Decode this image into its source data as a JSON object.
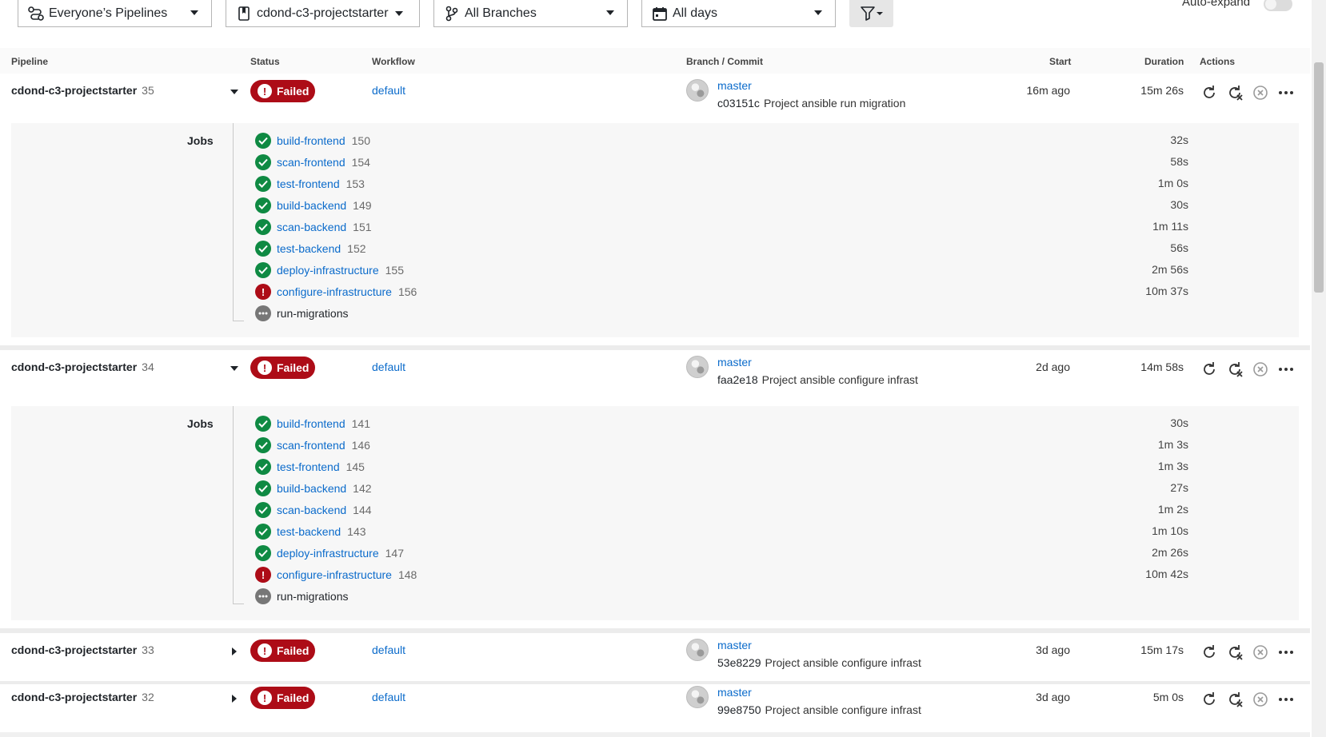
{
  "filters": {
    "pipelines": "Everyone’s Pipelines",
    "project": "cdond-c3-projectstarter",
    "branches": "All Branches",
    "days": "All days",
    "auto_expand": "Auto-expand"
  },
  "columns": {
    "pipeline": "Pipeline",
    "status": "Status",
    "workflow": "Workflow",
    "branch_commit": "Branch / Commit",
    "start": "Start",
    "duration": "Duration",
    "actions": "Actions"
  },
  "jobs_label": "Jobs",
  "colors": {
    "failed": "#ad0c17",
    "success": "#0f8a43",
    "link": "#0b6bcb"
  },
  "pipelines": [
    {
      "name": "cdond-c3-projectstarter",
      "number": "35",
      "status": "Failed",
      "workflow": "default",
      "branch": "master",
      "sha": "c03151c",
      "message": "Project ansible run migration",
      "start": "16m ago",
      "duration": "15m 26s",
      "jobs": [
        {
          "name": "build-frontend",
          "number": "150",
          "duration": "32s",
          "status": "success"
        },
        {
          "name": "scan-frontend",
          "number": "154",
          "duration": "58s",
          "status": "success"
        },
        {
          "name": "test-frontend",
          "number": "153",
          "duration": "1m 0s",
          "status": "success"
        },
        {
          "name": "build-backend",
          "number": "149",
          "duration": "30s",
          "status": "success"
        },
        {
          "name": "scan-backend",
          "number": "151",
          "duration": "1m 11s",
          "status": "success"
        },
        {
          "name": "test-backend",
          "number": "152",
          "duration": "56s",
          "status": "success"
        },
        {
          "name": "deploy-infrastructure",
          "number": "155",
          "duration": "2m 56s",
          "status": "success"
        },
        {
          "name": "configure-infrastructure",
          "number": "156",
          "duration": "10m 37s",
          "status": "failed"
        },
        {
          "name": "run-migrations",
          "number": "",
          "duration": "",
          "status": "not-run"
        }
      ]
    },
    {
      "name": "cdond-c3-projectstarter",
      "number": "34",
      "status": "Failed",
      "workflow": "default",
      "branch": "master",
      "sha": "faa2e18",
      "message": "Project ansible configure infrast",
      "start": "2d ago",
      "duration": "14m 58s",
      "jobs": [
        {
          "name": "build-frontend",
          "number": "141",
          "duration": "30s",
          "status": "success"
        },
        {
          "name": "scan-frontend",
          "number": "146",
          "duration": "1m 3s",
          "status": "success"
        },
        {
          "name": "test-frontend",
          "number": "145",
          "duration": "1m 3s",
          "status": "success"
        },
        {
          "name": "build-backend",
          "number": "142",
          "duration": "27s",
          "status": "success"
        },
        {
          "name": "scan-backend",
          "number": "144",
          "duration": "1m 2s",
          "status": "success"
        },
        {
          "name": "test-backend",
          "number": "143",
          "duration": "1m 10s",
          "status": "success"
        },
        {
          "name": "deploy-infrastructure",
          "number": "147",
          "duration": "2m 26s",
          "status": "success"
        },
        {
          "name": "configure-infrastructure",
          "number": "148",
          "duration": "10m 42s",
          "status": "failed"
        },
        {
          "name": "run-migrations",
          "number": "",
          "duration": "",
          "status": "not-run"
        }
      ]
    },
    {
      "name": "cdond-c3-projectstarter",
      "number": "33",
      "status": "Failed",
      "workflow": "default",
      "branch": "master",
      "sha": "53e8229",
      "message": "Project ansible configure infrast",
      "start": "3d ago",
      "duration": "15m 17s"
    },
    {
      "name": "cdond-c3-projectstarter",
      "number": "32",
      "status": "Failed",
      "workflow": "default",
      "branch": "master",
      "sha": "99e8750",
      "message": "Project ansible configure infrast",
      "start": "3d ago",
      "duration": "5m 0s"
    }
  ]
}
